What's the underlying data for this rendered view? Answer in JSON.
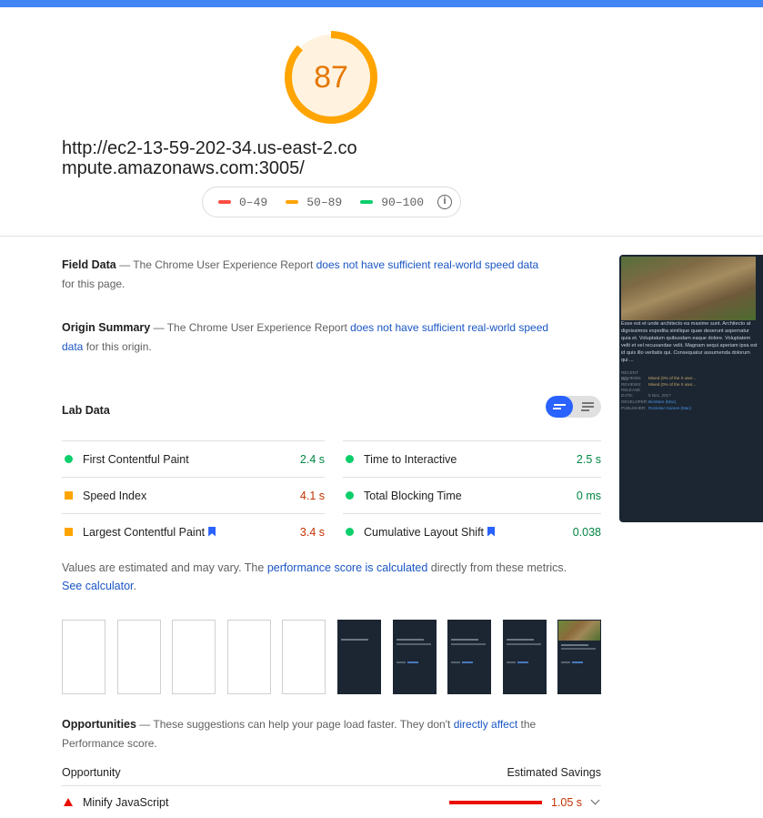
{
  "score": {
    "value": "87",
    "fraction": 0.87,
    "color": "#ffa400"
  },
  "url": "http://ec2-13-59-202-34.us-east-2.compute.amazonaws.com:3005/",
  "legend": [
    {
      "range": "0–49",
      "color": "#ff4e42"
    },
    {
      "range": "50–89",
      "color": "#ffa400"
    },
    {
      "range": "90–100",
      "color": "#0cce6b"
    }
  ],
  "field_data": {
    "title": "Field Data",
    "dash": " — The Chrome User Experience Report ",
    "link": "does not have sufficient real-world speed data",
    "tail": " for this page."
  },
  "origin_summary": {
    "title": "Origin Summary",
    "dash": " — The Chrome User Experience Report ",
    "link": "does not have sufficient real-world speed data",
    "tail": " for this origin."
  },
  "lab_data": {
    "title": "Lab Data",
    "metrics": [
      {
        "label": "First Contentful Paint",
        "value": "2.4 s",
        "status": "good"
      },
      {
        "label": "Time to Interactive",
        "value": "2.5 s",
        "status": "good"
      },
      {
        "label": "Speed Index",
        "value": "4.1 s",
        "status": "average"
      },
      {
        "label": "Total Blocking Time",
        "value": "0 ms",
        "status": "good"
      },
      {
        "label": "Largest Contentful Paint",
        "value": "3.4 s",
        "status": "average"
      },
      {
        "label": "Cumulative Layout Shift",
        "value": "0.038",
        "status": "good"
      }
    ]
  },
  "disclaimer": {
    "pre": "Values are estimated and may vary. The ",
    "link1": "performance score is calculated",
    "mid": " directly from these metrics. ",
    "link2": "See calculator",
    "post": "."
  },
  "opportunities": {
    "title": "Opportunities",
    "dash": " — These suggestions can help your page load faster. They don't ",
    "link": "directly affect",
    "tail": " the Performance score.",
    "col_opportunity": "Opportunity",
    "col_savings": "Estimated Savings",
    "items": [
      {
        "label": "Minify JavaScript",
        "savings": "1.05 s"
      }
    ]
  },
  "preview": {
    "description": "Esse est et unde architecto ea maxime sunt. Architecto at dignissimos expedita similique quae deserunt aspernatur quia et. Voluptatum quibusdam eaque dolore. Voluptatem velit et vel recusandae velit. Magnam sequi aperiam ipsa est id quis illo veritatis qui. Consequatur assumenda dolorum qui ...",
    "rows": [
      {
        "key": "RECENT REVIEWS:",
        "value": "Mixed (0% of the 0 user..."
      },
      {
        "key": "ALL REVIEWS:",
        "value": "Mixed (0% of the 0 user..."
      },
      {
        "key": "RELEASE DATE:",
        "value": "6 Dec, 2017"
      },
      {
        "key": "DEVELOPER:",
        "value": "BioWare (Mac)"
      },
      {
        "key": "PUBLISHER:",
        "value": "Rockstar Games (Mac)"
      }
    ]
  }
}
